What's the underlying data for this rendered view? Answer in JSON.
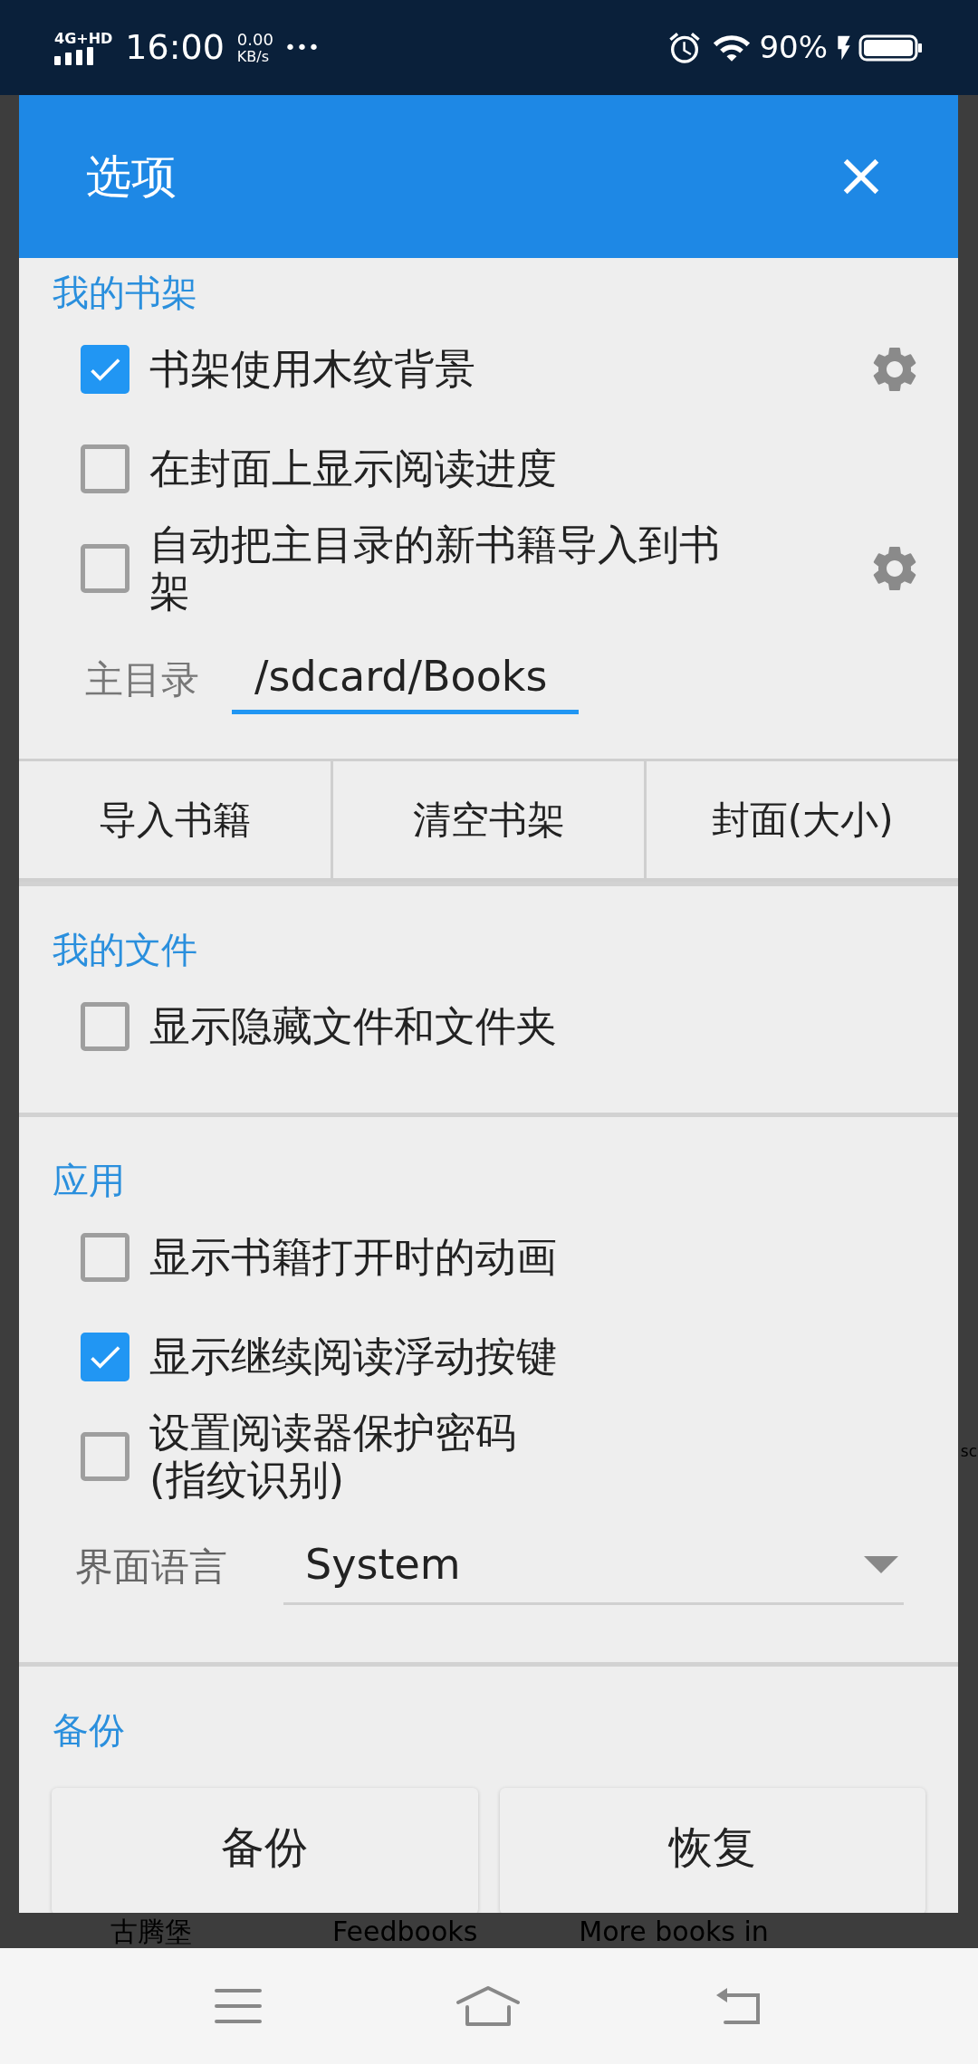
{
  "status_bar": {
    "network": "4G+HD",
    "time": "16:00",
    "speed_value": "0.00",
    "speed_unit": "KB/s",
    "overflow": "•••",
    "battery": "90%"
  },
  "dialog": {
    "title": "选项",
    "sections": [
      {
        "title": "我的书架",
        "items": [
          {
            "kind": "checkbox",
            "label": "书架使用木纹背景",
            "checked": true,
            "has_settings": true
          },
          {
            "kind": "checkbox",
            "label": "在封面上显示阅读进度",
            "checked": false,
            "has_settings": false
          },
          {
            "kind": "checkbox",
            "label": "自动把主目录的新书籍导入到书架",
            "checked": false,
            "has_settings": true
          },
          {
            "kind": "path_field",
            "label": "主目录",
            "value": "/sdcard/Books"
          },
          {
            "kind": "button_row",
            "buttons": [
              "导入书籍",
              "清空书架",
              "封面(大小)"
            ]
          }
        ]
      },
      {
        "title": "我的文件",
        "items": [
          {
            "kind": "checkbox",
            "label": "显示隐藏文件和文件夹",
            "checked": false,
            "has_settings": false
          }
        ]
      },
      {
        "title": "应用",
        "items": [
          {
            "kind": "checkbox",
            "label": "显示书籍打开时的动画",
            "checked": false,
            "has_settings": false
          },
          {
            "kind": "checkbox",
            "label": "显示继续阅读浮动按键",
            "checked": true,
            "has_settings": false
          },
          {
            "kind": "checkbox",
            "label": "设置阅读器保护密码\n(指纹识别)",
            "checked": false,
            "has_settings": false
          },
          {
            "kind": "dropdown",
            "label": "界面语言",
            "value": "System"
          }
        ]
      },
      {
        "title": "备份",
        "items": [
          {
            "kind": "card_buttons",
            "buttons": [
              "备份",
              "恢复"
            ]
          }
        ]
      }
    ]
  },
  "background": {
    "labels": [
      "古腾堡",
      "Feedbooks",
      "More books in"
    ],
    "edge_text": "sc"
  }
}
